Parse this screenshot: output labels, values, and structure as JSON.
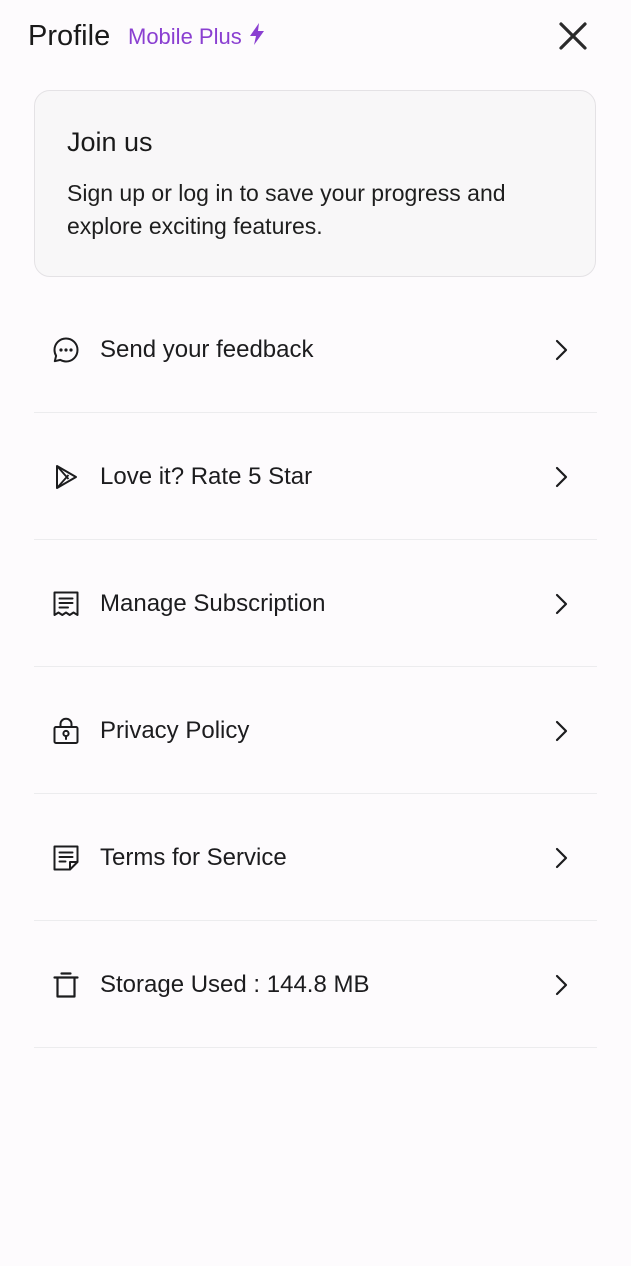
{
  "header": {
    "title": "Profile",
    "plan_label": "Mobile Plus",
    "plan_icon": "bolt-icon",
    "close_icon": "close-icon"
  },
  "join_card": {
    "title": "Join us",
    "text": "Sign up or log in to save your progress and explore exciting features."
  },
  "menu": {
    "items": [
      {
        "label": "Send your feedback",
        "icon": "chat-bubble-icon"
      },
      {
        "label": "Love it? Rate 5 Star",
        "icon": "play-store-icon"
      },
      {
        "label": "Manage Subscription",
        "icon": "receipt-icon"
      },
      {
        "label": "Privacy Policy",
        "icon": "lock-icon"
      },
      {
        "label": "Terms for Service",
        "icon": "document-icon"
      },
      {
        "label": "Storage Used : 144.8 MB",
        "icon": "trash-icon"
      }
    ]
  },
  "colors": {
    "accent": "#8a3fd1",
    "background": "#fdfbfd",
    "card_background": "#f8f7f8",
    "text": "#1c1c1e"
  }
}
